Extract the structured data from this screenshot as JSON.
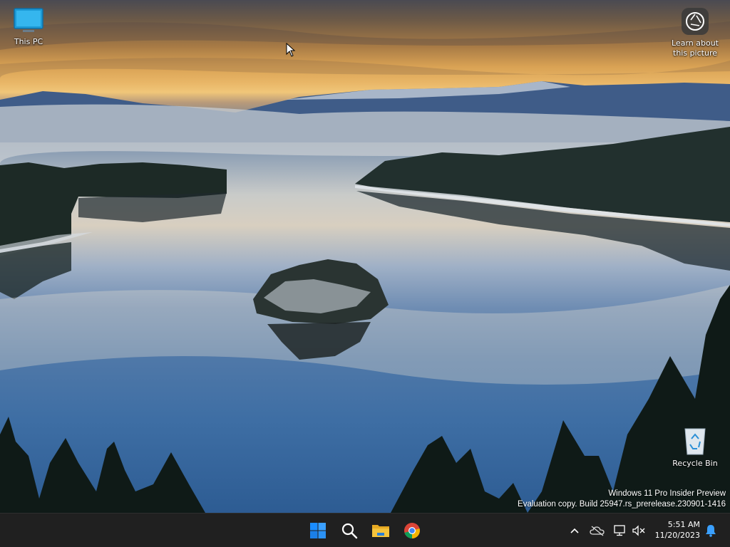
{
  "desktop": {
    "icons": [
      {
        "label": "This PC",
        "icon": "monitor-icon"
      },
      {
        "label": "Learn about this picture",
        "icon": "camera-circle-icon"
      },
      {
        "label": "Recycle Bin",
        "icon": "recycle-bin-icon"
      }
    ],
    "watermark": {
      "line1": "Windows 11 Pro Insider Preview",
      "line2": "Evaluation copy. Build 25947.rs_prerelease.230901-1416"
    }
  },
  "taskbar": {
    "apps": [
      {
        "name": "Start",
        "icon": "windows-logo-icon"
      },
      {
        "name": "Search",
        "icon": "search-icon"
      },
      {
        "name": "File Explorer",
        "icon": "folder-icon"
      },
      {
        "name": "Google Chrome",
        "icon": "chrome-icon"
      }
    ],
    "tray": {
      "icons": [
        "chevron-up-icon",
        "onedrive-off-icon",
        "network-icon",
        "volume-muted-icon",
        "bell-icon"
      ]
    },
    "clock": {
      "time": "5:51 AM",
      "date": "11/20/2023"
    }
  },
  "colors": {
    "taskbar_bg": "#202020",
    "accent": "#1a8cff",
    "folder_yellow": "#f4c33c"
  }
}
